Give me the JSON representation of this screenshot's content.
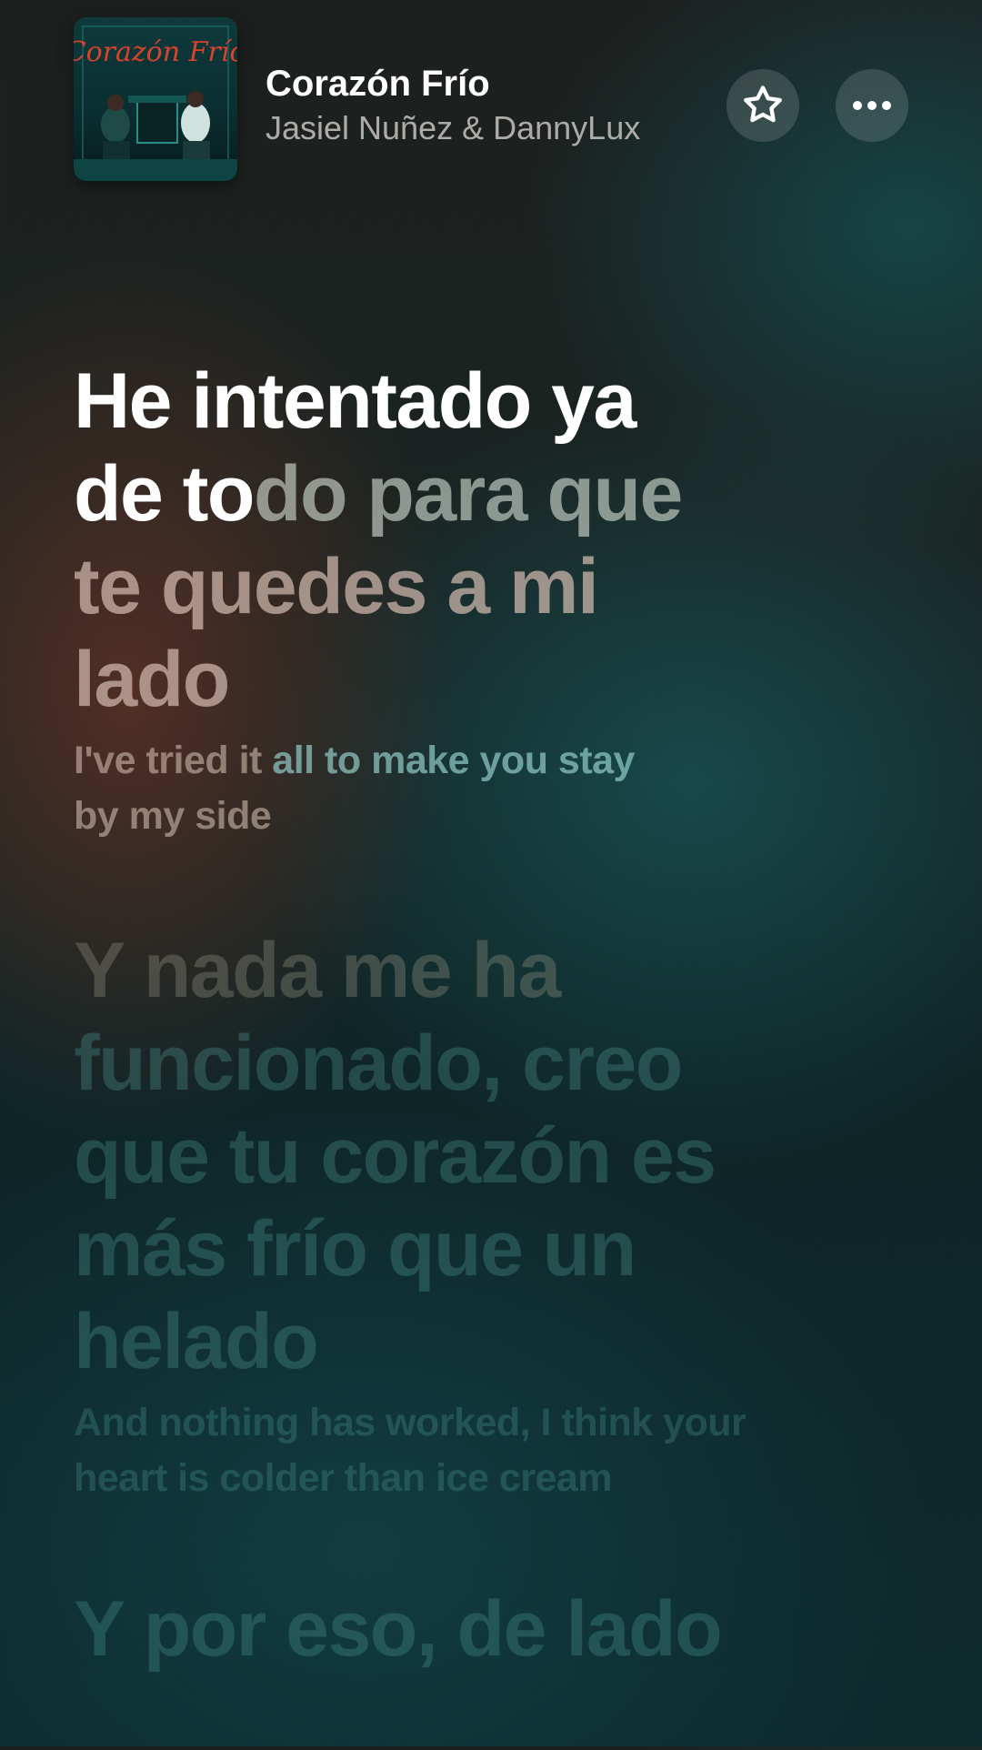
{
  "now_playing": {
    "title": "Corazón Frío",
    "artist": "Jasiel Nuñez & DannyLux",
    "album_art_icon": "album-art",
    "album_art_text": "Corazón Frío"
  },
  "actions": {
    "favorite_icon": "star-icon",
    "more_icon": "ellipsis-icon"
  },
  "lyrics": {
    "active": {
      "sung_part1": "He intentado ya",
      "sung_part2": "de to",
      "pending_part1": "do para que",
      "pending_part2": "te quedes a mi",
      "pending_part3": "lado",
      "translation_part1": "I've tried it ",
      "translation_part2": "all to make you stay",
      "translation_part3": "by my side"
    },
    "next": {
      "original_row1": "Y nada me ha",
      "original_rest": "funcionado, creo que tu corazón es más frío que un helado",
      "translation": "And nothing has worked, I think your heart is colder than ice cream"
    },
    "following": {
      "original": "Y por eso, de lado"
    }
  },
  "colors": {
    "active_text": "#ffffff",
    "background_dark": "#0f2526",
    "accent_teal": "#4a9692"
  }
}
